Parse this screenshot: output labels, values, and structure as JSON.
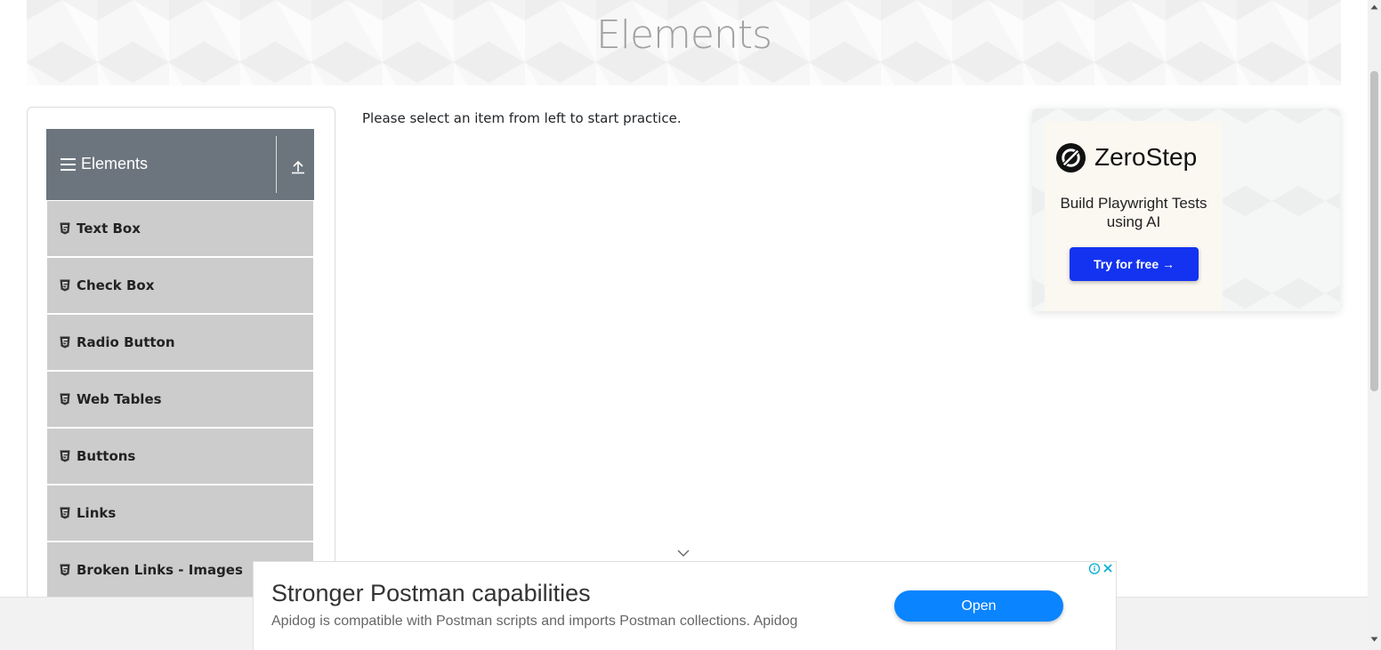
{
  "banner": {
    "title": "Elements"
  },
  "sidebar": {
    "group_title": "Elements",
    "items": [
      {
        "label": "Text Box"
      },
      {
        "label": "Check Box"
      },
      {
        "label": "Radio Button"
      },
      {
        "label": "Web Tables"
      },
      {
        "label": "Buttons"
      },
      {
        "label": "Links"
      },
      {
        "label": "Broken Links - Images"
      }
    ]
  },
  "main": {
    "instruction": "Please select an item from left to start practice."
  },
  "side_ad": {
    "brand": "ZeroStep",
    "tagline": "Build Playwright Tests using AI",
    "cta": "Try for free →"
  },
  "bottom_ad": {
    "title": "Stronger Postman capabilities",
    "description": "Apidog is compatible with Postman scripts and imports Postman collections. Apidog",
    "cta": "Open"
  },
  "colors": {
    "group_header": "#6c757d",
    "menu_item": "#cccccc",
    "zerostep_button": "#1433f0",
    "open_button": "#0a84ff"
  },
  "icons": {
    "group": "hamburger-icon",
    "collapse": "arrow-up-icon",
    "menu_item": "html5-icon",
    "scroll_hint": "chevron-down-icon",
    "ad_choices": "adchoices-icon",
    "ad_close": "close-icon"
  }
}
